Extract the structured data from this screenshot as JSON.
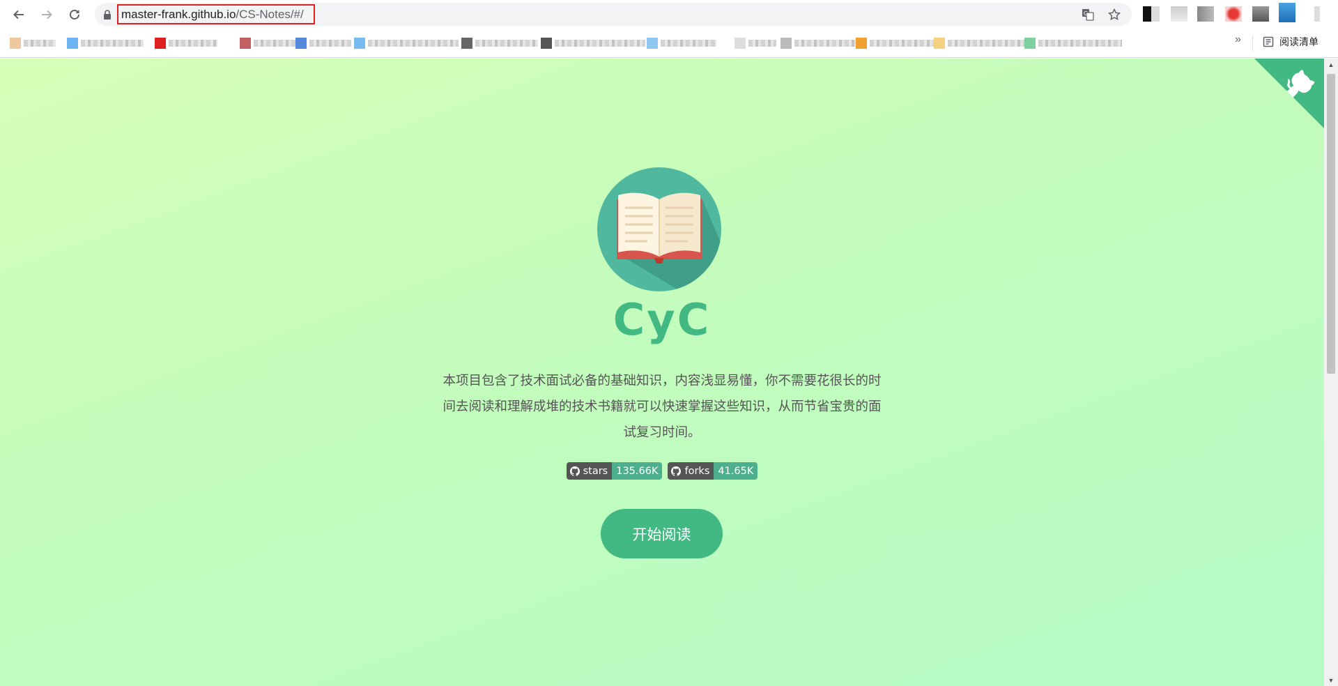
{
  "browser": {
    "url_host": "master-frank.github.io",
    "url_path": "/CS-Notes",
    "url_rest": "/#/",
    "reading_list_label": "阅读清单",
    "overflow_label": "»"
  },
  "page": {
    "title": "CyC",
    "description": "本项目包含了技术面试必备的基础知识，内容浅显易懂，你不需要花很长的时间去阅读和理解成堆的技术书籍就可以快速掌握这些知识，从而节省宝贵的面试复习时间。",
    "badges": [
      {
        "label": "stars",
        "value": "135.66K"
      },
      {
        "label": "forks",
        "value": "41.65K"
      }
    ],
    "start_button": "开始阅读"
  },
  "colors": {
    "accent": "#42b983",
    "badge_left": "#555555",
    "badge_right": "#4daf8e",
    "url_highlight": "#e02020"
  },
  "icons": [
    "back-icon",
    "forward-icon",
    "reload-icon",
    "lock-icon",
    "translate-icon",
    "star-icon",
    "reading-list-icon",
    "github-icon",
    "book-icon",
    "octocat-icon"
  ]
}
